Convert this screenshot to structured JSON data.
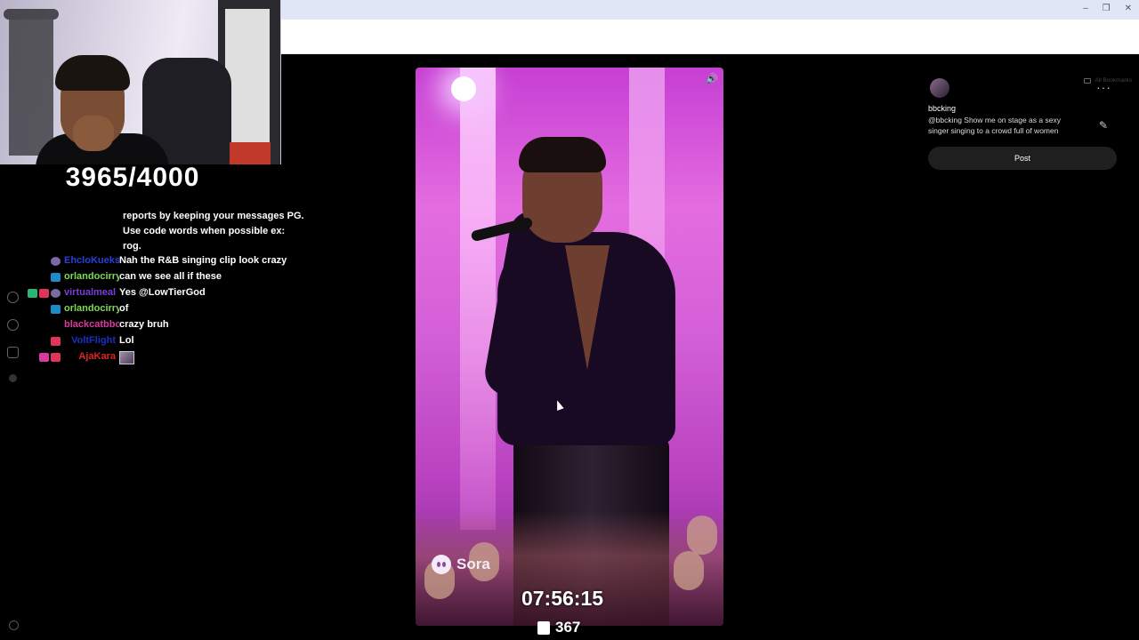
{
  "stream": {
    "goal_counter": "3965/4000",
    "uptime": "07:56:15",
    "viewers": "367"
  },
  "chat": {
    "continuation": [
      "reports by keeping your messages PG.",
      "Use code words when possible ex:",
      "rog."
    ],
    "messages": [
      {
        "user": "EhcloKueks",
        "color": "#2a3fd6",
        "text": "Nah the R&B singing clip look crazy"
      },
      {
        "user": "orlandocirry",
        "color": "#7ed957",
        "text": "can we see all if these"
      },
      {
        "user": "virtualmeal",
        "color": "#7a3fd9",
        "text": "Yes @LowTierGod"
      },
      {
        "user": "orlandocirry",
        "color": "#7ed957",
        "text": "of"
      },
      {
        "user": "blackcatbbc",
        "color": "#d63a9c",
        "text": "crazy bruh"
      },
      {
        "user": "VoltFlight",
        "color": "#1a2fbf",
        "text": "Lol"
      },
      {
        "user": "AjaKara",
        "color": "#e02424",
        "text": ""
      }
    ]
  },
  "browser": {
    "bookmarks_label": "All Bookmarks",
    "window_controls": [
      "–",
      "❐",
      "✕"
    ]
  },
  "video": {
    "watermark": "Sora",
    "icon": "volume-icon"
  },
  "post": {
    "username": "bbcking",
    "caption": "@bbcking Show me on stage as a sexy singer singing to a crowd full of women",
    "button_label": "Post",
    "more_label": "···",
    "edit_icon": "✎"
  }
}
